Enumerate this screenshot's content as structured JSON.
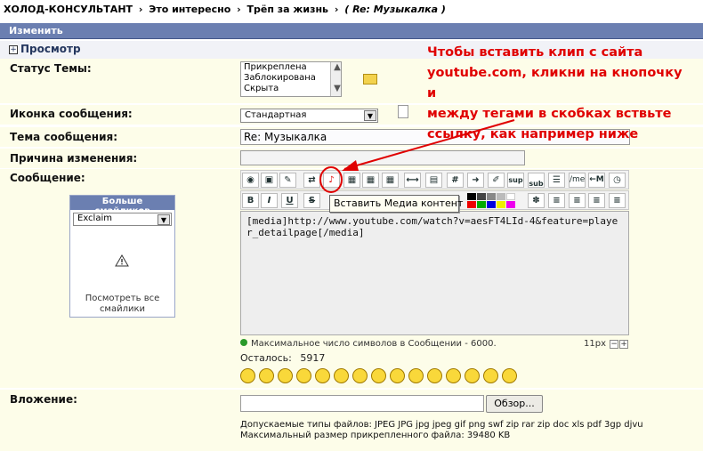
{
  "breadcrumb": {
    "site": "ХОЛОД-КОНСУЛЬТАНТ",
    "section": "Это интересно",
    "thread": "Трёп за жизнь",
    "current": "( Re: Музыкалка )",
    "separator": "›"
  },
  "header": {
    "title": "Изменить"
  },
  "preview": {
    "label": "Просмотр",
    "toggle": "+"
  },
  "status": {
    "label": "Статус Темы:",
    "options": [
      "Прикреплена",
      "Заблокирована",
      "Скрыта"
    ]
  },
  "icon_field": {
    "label": "Иконка сообщения:",
    "value": "Стандартная"
  },
  "subject": {
    "label": "Тема сообщения:",
    "value": "Re: Музыкалка"
  },
  "reason": {
    "label": "Причина изменения:",
    "value": ""
  },
  "message": {
    "label": "Сообщение:",
    "text": "[media]http://www.youtube.com/watch?v=aesFT4LId-4&feature=player_detailpage[/media]",
    "tooltip": "Вставить Медиа контент",
    "max_chars": "Максимальное число символов в Сообщении - 6000.",
    "remaining_label": "Осталось:",
    "remaining_value": "5917",
    "font_size": "11px"
  },
  "toolbar": {
    "sup": "sup",
    "sub": "sub",
    "hash": "#",
    "me": "/me",
    "m": "←M",
    "bold": "B",
    "italic": "I",
    "underline": "U",
    "strike": "S"
  },
  "smilies": {
    "title": "Больше смайликов",
    "category": "Exclaim",
    "more_link": "Посмотреть все смайлики"
  },
  "attachment": {
    "label": "Вложение:",
    "browse": "Обзор...",
    "types": "Допускаемые типы файлов: JPEG JPG jpg jpeg gif png swf zip rar zip doc xls pdf 3gp djvu",
    "max_size": "Максимальный размер прикрепленного файла: 39480 KB"
  },
  "annotation": {
    "line1": "Чтобы вставить клип с сайта",
    "line2a": "youtube.com",
    "line2b": ", кликни на кнопочку и",
    "line3": "между тегами в скобках вствьте",
    "line4": "ссылку, как например ниже"
  },
  "colors": {
    "header": "#6b7fb1",
    "band": "#fdfde9",
    "annotation": "#e00000"
  }
}
